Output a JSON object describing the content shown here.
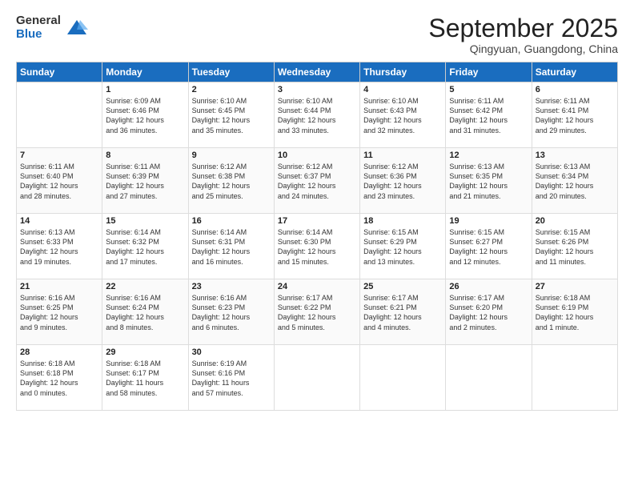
{
  "logo": {
    "general": "General",
    "blue": "Blue"
  },
  "header": {
    "month": "September 2025",
    "location": "Qingyuan, Guangdong, China"
  },
  "weekdays": [
    "Sunday",
    "Monday",
    "Tuesday",
    "Wednesday",
    "Thursday",
    "Friday",
    "Saturday"
  ],
  "weeks": [
    [
      {
        "day": "",
        "info": ""
      },
      {
        "day": "1",
        "info": "Sunrise: 6:09 AM\nSunset: 6:46 PM\nDaylight: 12 hours\nand 36 minutes."
      },
      {
        "day": "2",
        "info": "Sunrise: 6:10 AM\nSunset: 6:45 PM\nDaylight: 12 hours\nand 35 minutes."
      },
      {
        "day": "3",
        "info": "Sunrise: 6:10 AM\nSunset: 6:44 PM\nDaylight: 12 hours\nand 33 minutes."
      },
      {
        "day": "4",
        "info": "Sunrise: 6:10 AM\nSunset: 6:43 PM\nDaylight: 12 hours\nand 32 minutes."
      },
      {
        "day": "5",
        "info": "Sunrise: 6:11 AM\nSunset: 6:42 PM\nDaylight: 12 hours\nand 31 minutes."
      },
      {
        "day": "6",
        "info": "Sunrise: 6:11 AM\nSunset: 6:41 PM\nDaylight: 12 hours\nand 29 minutes."
      }
    ],
    [
      {
        "day": "7",
        "info": "Sunrise: 6:11 AM\nSunset: 6:40 PM\nDaylight: 12 hours\nand 28 minutes."
      },
      {
        "day": "8",
        "info": "Sunrise: 6:11 AM\nSunset: 6:39 PM\nDaylight: 12 hours\nand 27 minutes."
      },
      {
        "day": "9",
        "info": "Sunrise: 6:12 AM\nSunset: 6:38 PM\nDaylight: 12 hours\nand 25 minutes."
      },
      {
        "day": "10",
        "info": "Sunrise: 6:12 AM\nSunset: 6:37 PM\nDaylight: 12 hours\nand 24 minutes."
      },
      {
        "day": "11",
        "info": "Sunrise: 6:12 AM\nSunset: 6:36 PM\nDaylight: 12 hours\nand 23 minutes."
      },
      {
        "day": "12",
        "info": "Sunrise: 6:13 AM\nSunset: 6:35 PM\nDaylight: 12 hours\nand 21 minutes."
      },
      {
        "day": "13",
        "info": "Sunrise: 6:13 AM\nSunset: 6:34 PM\nDaylight: 12 hours\nand 20 minutes."
      }
    ],
    [
      {
        "day": "14",
        "info": "Sunrise: 6:13 AM\nSunset: 6:33 PM\nDaylight: 12 hours\nand 19 minutes."
      },
      {
        "day": "15",
        "info": "Sunrise: 6:14 AM\nSunset: 6:32 PM\nDaylight: 12 hours\nand 17 minutes."
      },
      {
        "day": "16",
        "info": "Sunrise: 6:14 AM\nSunset: 6:31 PM\nDaylight: 12 hours\nand 16 minutes."
      },
      {
        "day": "17",
        "info": "Sunrise: 6:14 AM\nSunset: 6:30 PM\nDaylight: 12 hours\nand 15 minutes."
      },
      {
        "day": "18",
        "info": "Sunrise: 6:15 AM\nSunset: 6:29 PM\nDaylight: 12 hours\nand 13 minutes."
      },
      {
        "day": "19",
        "info": "Sunrise: 6:15 AM\nSunset: 6:27 PM\nDaylight: 12 hours\nand 12 minutes."
      },
      {
        "day": "20",
        "info": "Sunrise: 6:15 AM\nSunset: 6:26 PM\nDaylight: 12 hours\nand 11 minutes."
      }
    ],
    [
      {
        "day": "21",
        "info": "Sunrise: 6:16 AM\nSunset: 6:25 PM\nDaylight: 12 hours\nand 9 minutes."
      },
      {
        "day": "22",
        "info": "Sunrise: 6:16 AM\nSunset: 6:24 PM\nDaylight: 12 hours\nand 8 minutes."
      },
      {
        "day": "23",
        "info": "Sunrise: 6:16 AM\nSunset: 6:23 PM\nDaylight: 12 hours\nand 6 minutes."
      },
      {
        "day": "24",
        "info": "Sunrise: 6:17 AM\nSunset: 6:22 PM\nDaylight: 12 hours\nand 5 minutes."
      },
      {
        "day": "25",
        "info": "Sunrise: 6:17 AM\nSunset: 6:21 PM\nDaylight: 12 hours\nand 4 minutes."
      },
      {
        "day": "26",
        "info": "Sunrise: 6:17 AM\nSunset: 6:20 PM\nDaylight: 12 hours\nand 2 minutes."
      },
      {
        "day": "27",
        "info": "Sunrise: 6:18 AM\nSunset: 6:19 PM\nDaylight: 12 hours\nand 1 minute."
      }
    ],
    [
      {
        "day": "28",
        "info": "Sunrise: 6:18 AM\nSunset: 6:18 PM\nDaylight: 12 hours\nand 0 minutes."
      },
      {
        "day": "29",
        "info": "Sunrise: 6:18 AM\nSunset: 6:17 PM\nDaylight: 11 hours\nand 58 minutes."
      },
      {
        "day": "30",
        "info": "Sunrise: 6:19 AM\nSunset: 6:16 PM\nDaylight: 11 hours\nand 57 minutes."
      },
      {
        "day": "",
        "info": ""
      },
      {
        "day": "",
        "info": ""
      },
      {
        "day": "",
        "info": ""
      },
      {
        "day": "",
        "info": ""
      }
    ]
  ]
}
